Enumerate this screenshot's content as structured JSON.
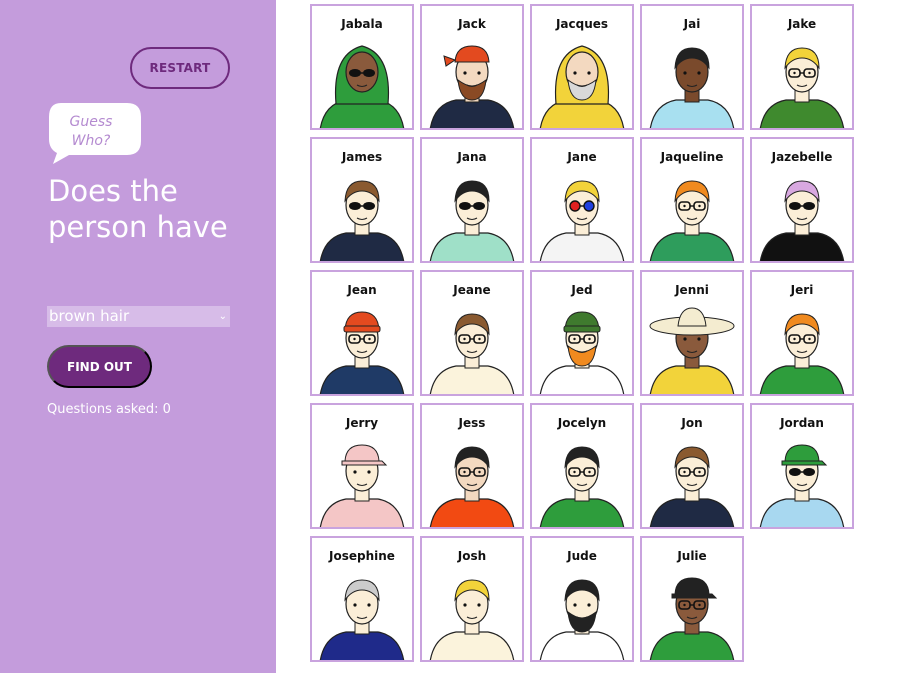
{
  "sidebar": {
    "restart_label": "RESTART",
    "logo_line1": "Guess",
    "logo_line2": "Who?",
    "question": "Does the person have",
    "select_value": "brown hair",
    "find_out_label": "FIND OUT",
    "questions_asked": "Questions asked: 0"
  },
  "characters": [
    {
      "name": "Jabala",
      "hair": "#2e9d3c",
      "shirt": "#2e9d3c",
      "skin": "#8a5a3c",
      "glasses": "sunglasses",
      "hat": "hood"
    },
    {
      "name": "Jack",
      "hair": "#e34a1f",
      "shirt": "#1f2a44",
      "skin": "#f3d9c0",
      "glasses": "none",
      "hat": "bandana",
      "beard": "#8a4a24"
    },
    {
      "name": "Jacques",
      "hair": "#f2d33a",
      "shirt": "#f2d33a",
      "skin": "#f3d9c0",
      "glasses": "none",
      "hat": "hood",
      "beard": "#d9d9d9"
    },
    {
      "name": "Jai",
      "hair": "#222222",
      "shirt": "#a8e0f0",
      "skin": "#7a4a2c",
      "glasses": "none",
      "hat": "none"
    },
    {
      "name": "Jake",
      "hair": "#f2d33a",
      "shirt": "#3f8a2e",
      "skin": "#fbeed7",
      "glasses": "regular",
      "hat": "none"
    },
    {
      "name": "James",
      "hair": "#8a5a30",
      "shirt": "#1f2a44",
      "skin": "#fbeed7",
      "glasses": "sunglasses",
      "hat": "none"
    },
    {
      "name": "Jana",
      "hair": "#222222",
      "shirt": "#9fe0c8",
      "skin": "#fbeed7",
      "glasses": "sunglasses",
      "hat": "none"
    },
    {
      "name": "Jane",
      "hair": "#f2d33a",
      "shirt": "#f4f4f4",
      "skin": "#fbeed7",
      "glasses": "colored",
      "hat": "none"
    },
    {
      "name": "Jaqueline",
      "hair": "#f08a1f",
      "shirt": "#2e9d5c",
      "skin": "#fbeed7",
      "glasses": "regular",
      "hat": "none"
    },
    {
      "name": "Jazebelle",
      "hair": "#d8a8e0",
      "shirt": "#111111",
      "skin": "#fbeed7",
      "glasses": "sunglasses",
      "hat": "none"
    },
    {
      "name": "Jean",
      "hair": "#e34a1f",
      "shirt": "#1f3a66",
      "skin": "#fbeed7",
      "glasses": "regular",
      "hat": "beanie"
    },
    {
      "name": "Jeane",
      "hair": "#8a5a30",
      "shirt": "#fbf3dc",
      "skin": "#fbeed7",
      "glasses": "regular",
      "hat": "none"
    },
    {
      "name": "Jed",
      "hair": "#3f7a2e",
      "shirt": "#ffffff",
      "skin": "#fbeed7",
      "glasses": "regular",
      "hat": "beanie",
      "beard": "#f08a1f"
    },
    {
      "name": "Jenni",
      "hair": "#f4ecd0",
      "shirt": "#f2d33a",
      "skin": "#8a5a3c",
      "glasses": "none",
      "hat": "sunhat"
    },
    {
      "name": "Jeri",
      "hair": "#f08a1f",
      "shirt": "#2e9d3c",
      "skin": "#fbeed7",
      "glasses": "regular",
      "hat": "none"
    },
    {
      "name": "Jerry",
      "hair": "#f4c6c6",
      "shirt": "#f4c6c6",
      "skin": "#fbeed7",
      "glasses": "none",
      "hat": "cap"
    },
    {
      "name": "Jess",
      "hair": "#222222",
      "shirt": "#f24a12",
      "skin": "#f3d9c0",
      "glasses": "regular",
      "hat": "none"
    },
    {
      "name": "Jocelyn",
      "hair": "#222222",
      "shirt": "#2e9d3c",
      "skin": "#fbeed7",
      "glasses": "regular",
      "hat": "none"
    },
    {
      "name": "Jon",
      "hair": "#8a5a30",
      "shirt": "#1f2a44",
      "skin": "#fbeed7",
      "glasses": "regular",
      "hat": "none"
    },
    {
      "name": "Jordan",
      "hair": "#2e9d3c",
      "shirt": "#a8d8f0",
      "skin": "#fbeed7",
      "glasses": "sunglasses",
      "hat": "cap"
    },
    {
      "name": "Josephine",
      "hair": "#cccccc",
      "shirt": "#1f2a8a",
      "skin": "#fbeed7",
      "glasses": "none",
      "hat": "none"
    },
    {
      "name": "Josh",
      "hair": "#f2d33a",
      "shirt": "#fbf3dc",
      "skin": "#fbeed7",
      "glasses": "none",
      "hat": "none"
    },
    {
      "name": "Jude",
      "hair": "#222222",
      "shirt": "#ffffff",
      "skin": "#fbeed7",
      "glasses": "none",
      "hat": "none",
      "beard": "#222222"
    },
    {
      "name": "Julie",
      "hair": "#222222",
      "shirt": "#2e9d3c",
      "skin": "#8a5a3c",
      "glasses": "regular",
      "hat": "cap"
    }
  ],
  "colors": {
    "sidebar_bg": "#c49cdc",
    "accent": "#6e2a7d",
    "card_border": "#c9a3de"
  }
}
